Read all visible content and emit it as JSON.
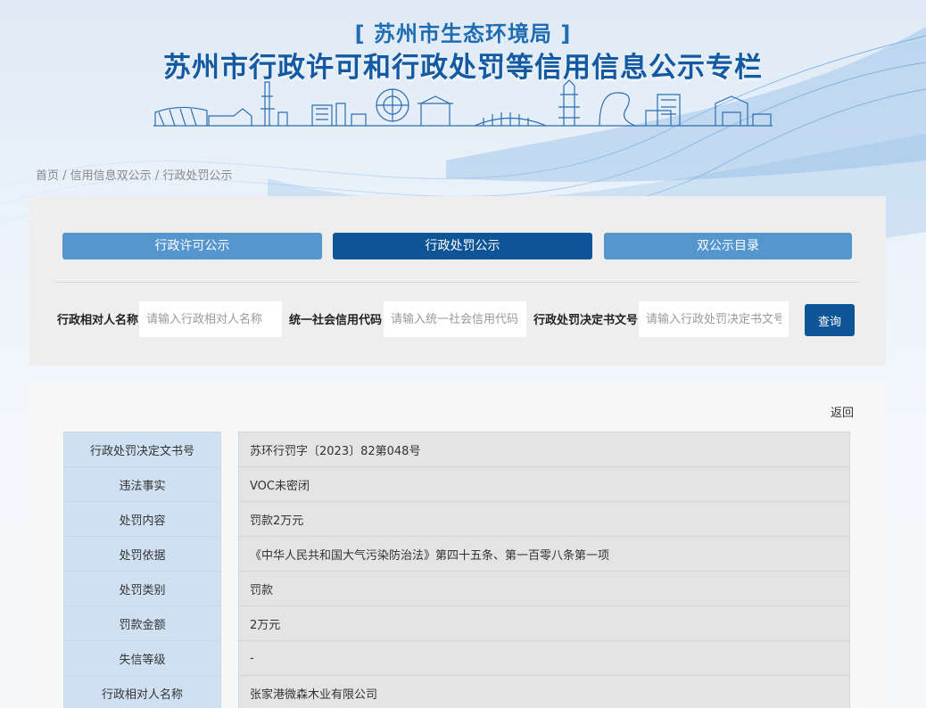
{
  "header": {
    "subtitle": "[ 苏州市生态环境局 ]",
    "title": "苏州市行政许可和行政处罚等信用信息公示专栏"
  },
  "breadcrumb": {
    "home": "首页",
    "sep1": " / ",
    "level2": "信用信息双公示",
    "sep2": " / ",
    "level3": "行政处罚公示"
  },
  "tabs": [
    {
      "label": "行政许可公示"
    },
    {
      "label": "行政处罚公示"
    },
    {
      "label": "双公示目录"
    }
  ],
  "search": {
    "name_label": "行政相对人名称",
    "name_placeholder": "请输入行政相对人名称",
    "code_label": "统一社会信用代码",
    "code_placeholder": "请输入统一社会信用代码",
    "doc_label": "行政处罚决定书文号",
    "doc_placeholder": "请输入行政处罚决定书文号",
    "query_label": "查询"
  },
  "detail": {
    "back_label": "返回",
    "rows": [
      {
        "key": "行政处罚决定文书号",
        "value": "苏环行罚字〔2023〕82第048号"
      },
      {
        "key": "违法事实",
        "value": "VOC未密闭"
      },
      {
        "key": "处罚内容",
        "value": "罚款2万元"
      },
      {
        "key": "处罚依据",
        "value": "《中华人民共和国大气污染防治法》第四十五条、第一百零八条第一项"
      },
      {
        "key": "处罚类别",
        "value": "罚款"
      },
      {
        "key": "罚款金额",
        "value": "2万元"
      },
      {
        "key": "失信等级",
        "value": "-"
      },
      {
        "key": "行政相对人名称",
        "value": "张家港微森木业有限公司"
      }
    ]
  },
  "colors": {
    "tab_active": "#0e5597",
    "tab_inactive": "#5596cf",
    "title": "#145aa3",
    "key_cell": "#cfe0f2",
    "value_cell": "#e4e4e4"
  }
}
